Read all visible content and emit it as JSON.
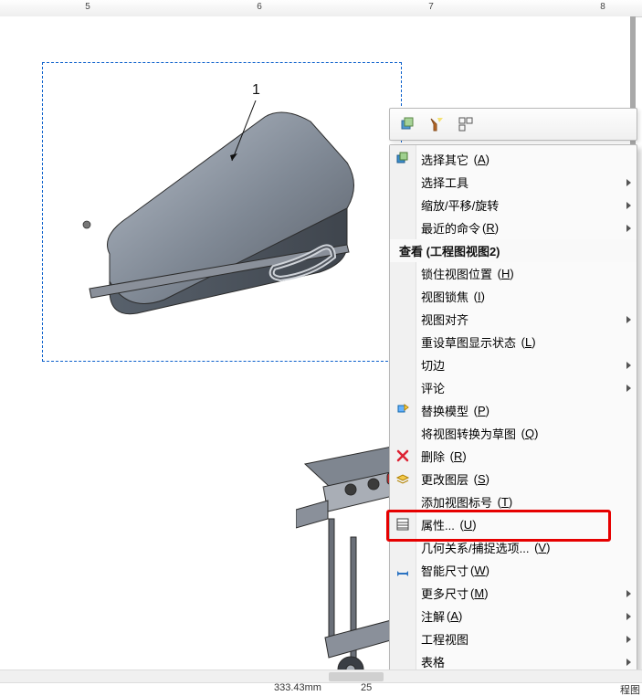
{
  "ruler": {
    "ticks": [
      "5",
      "6",
      "7",
      "8"
    ]
  },
  "leader_label": "1",
  "mini_toolbar": {
    "icons": [
      "select-other-icon",
      "flashlight-icon",
      "layout-icon"
    ]
  },
  "menu": {
    "section_title": "查看 (工程图视图2)",
    "items": {
      "select_other": {
        "label": "选择其它",
        "accel": "A",
        "icon": "select-other-icon"
      },
      "select_tools": {
        "label": "选择工具",
        "submenu": true
      },
      "zoom_pan_rotate": {
        "label": "缩放/平移/旋转",
        "submenu": true
      },
      "recent_commands": {
        "label": "最近的命令",
        "accel": "R",
        "submenu": true
      },
      "lock_view_pos": {
        "label": "锁住视图位置",
        "accel": "H"
      },
      "view_focus": {
        "label": "视图锁焦",
        "accel": "I"
      },
      "view_align": {
        "label": "视图对齐",
        "submenu": true
      },
      "reset_sketch_disp": {
        "label": "重设草图显示状态",
        "accel": "L"
      },
      "tangent_edges": {
        "label": "切边",
        "submenu": true
      },
      "comment": {
        "label": "评论",
        "submenu": true
      },
      "replace_model": {
        "label": "替换模型",
        "accel": "P",
        "icon": "replace-model-icon"
      },
      "convert_to_sketch": {
        "label": "将视图转换为草图",
        "accel": "Q"
      },
      "delete": {
        "label": "删除",
        "accel": "R",
        "icon": "delete-icon"
      },
      "change_layer": {
        "label": "更改图层",
        "accel": "S",
        "icon": "change-layer-icon"
      },
      "add_view_label": {
        "label": "添加视图标号",
        "accel": "T"
      },
      "properties": {
        "label": "属性...",
        "accel": "U",
        "icon": "properties-icon"
      },
      "relations_snap": {
        "label": "几何关系/捕捉选项...",
        "accel": "V"
      },
      "smart_dim": {
        "label": "智能尺寸",
        "accel": "W",
        "icon": "smart-dim-icon"
      },
      "more_dims": {
        "label": "更多尺寸",
        "accel": "M",
        "submenu": true
      },
      "annotate": {
        "label": "注解",
        "accel": "A",
        "submenu": true
      },
      "drawing_view": {
        "label": "工程视图",
        "submenu": true
      },
      "tables": {
        "label": "表格",
        "submenu": true
      }
    }
  },
  "status": {
    "coord_a": "333.43mm",
    "coord_b": "25",
    "right_label": "程图"
  }
}
